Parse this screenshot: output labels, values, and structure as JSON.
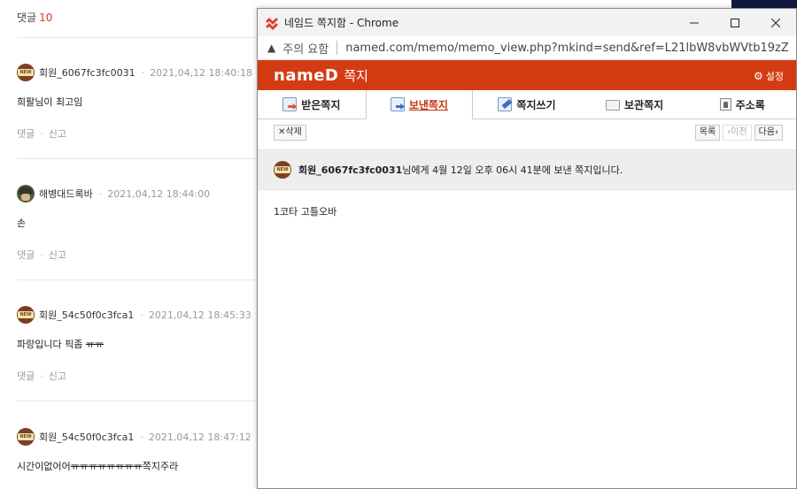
{
  "background": {
    "comment_count_label": "댓글",
    "comment_count": "10",
    "comments": [
      {
        "nick": "회원_6067fc3fc0031",
        "time": "2021,04,12 18:40:18",
        "body": "희팔님이 최고임",
        "avatar": "new",
        "reply": "댓글",
        "report": "신고"
      },
      {
        "nick": "해병대드록바",
        "time": "2021,04,12 18:44:00",
        "body": "손",
        "avatar": "military",
        "reply": "댓글",
        "report": "신고"
      },
      {
        "nick": "회원_54c50f0c3fca1",
        "time": "2021,04,12 18:45:33",
        "body_main": "파랑입니다 픽좀 ",
        "body_strike": "ㅠㅠ",
        "avatar": "new",
        "reply": "댓글",
        "report": "신고"
      },
      {
        "nick": "회원_54c50f0c3fca1",
        "time": "2021,04,12 18:47:12",
        "body_main": "시간이없어어",
        "body_strike": "ㅠㅠㅠㅠㅠㅠㅠㅠ",
        "body_tail": "쪽지주라",
        "avatar": "new",
        "reply": "댓글",
        "report": "신고"
      }
    ]
  },
  "popup": {
    "window_title": "네임드 쪽지함 - Chrome",
    "window_controls": {
      "minimize": "minimize-icon",
      "maximize": "maximize-icon",
      "close": "close-icon"
    },
    "address": {
      "warning_label": "주의 요함",
      "url": "named.com/memo/memo_view.php?mkind=send&ref=L21lbW8vbWVtb19zZW5..."
    },
    "brand": {
      "logo": "nameD",
      "section": "쪽지",
      "settings_label": "설정"
    },
    "tabs": [
      {
        "label": "받은쪽지",
        "icon": "inbox-envelope-icon"
      },
      {
        "label": "보낸쪽지",
        "icon": "sent-envelope-icon",
        "active": true
      },
      {
        "label": "쪽지쓰기",
        "icon": "compose-pen-icon"
      },
      {
        "label": "보관쪽지",
        "icon": "folder-icon"
      },
      {
        "label": "주소록",
        "icon": "address-book-icon"
      }
    ],
    "toolbar": {
      "delete_label": "✕삭제",
      "list_label": "목록",
      "prev_label": "‹이전",
      "next_label": "다음›"
    },
    "message": {
      "sender": "회원_6067fc3fc0031",
      "header_rest": "님에게 4월 12일 오후 06시 41분에 보낸 쪽지입니다.",
      "body": "1코타 고틀오바"
    },
    "colors": {
      "brand": "#d33c12",
      "active_tab": "#c4330c"
    }
  }
}
